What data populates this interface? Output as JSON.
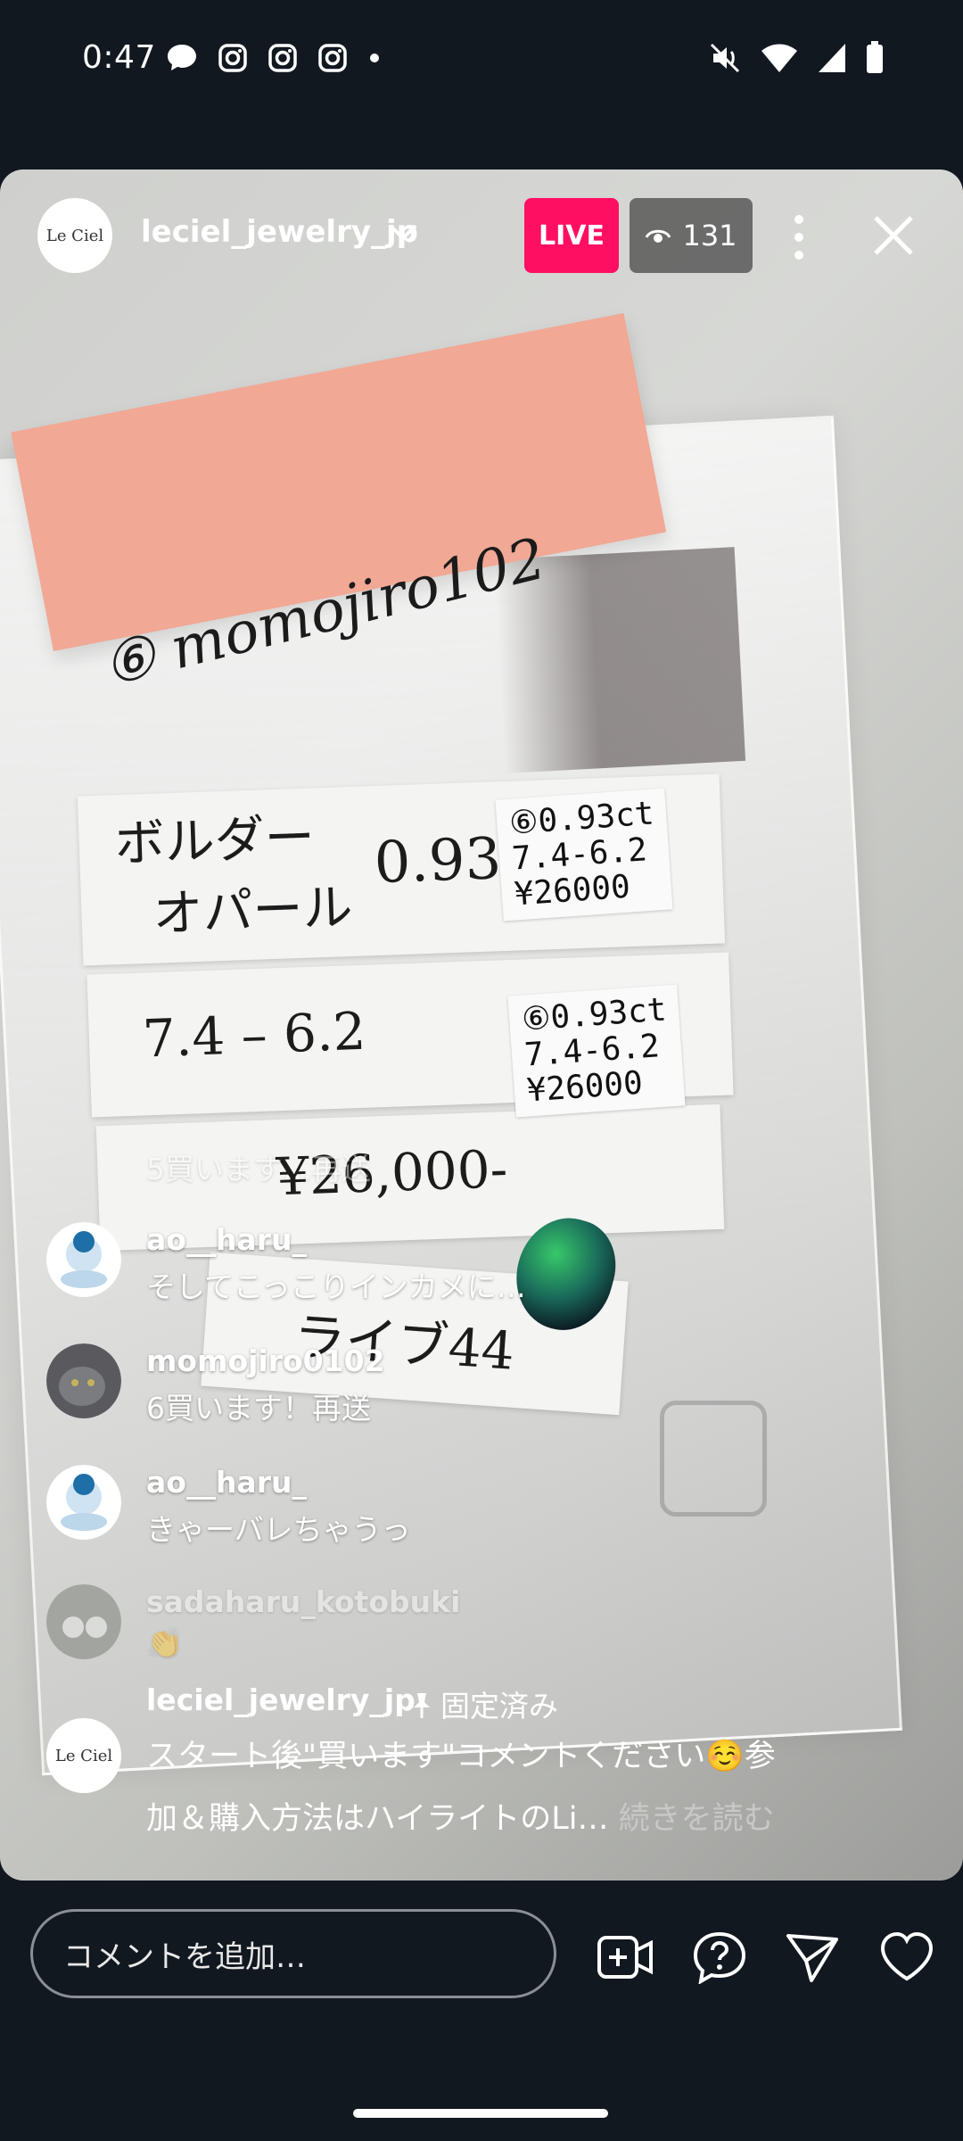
{
  "status_bar": {
    "time": "0:47",
    "left_icons": [
      "chat-bubble-icon",
      "instagram-icon",
      "instagram-icon",
      "instagram-icon",
      "dot-icon"
    ],
    "right_icons": [
      "mute-icon",
      "wifi-icon",
      "signal-icon",
      "battery-icon"
    ]
  },
  "live": {
    "host_avatar_text": "Le Ciel",
    "host_username": "leciel_jewelry_jp",
    "live_label": "LIVE",
    "viewer_count": "131",
    "colors": {
      "live_badge": "#ff0f62"
    }
  },
  "scene": {
    "sticky_note": "⑥ momojiro102",
    "card1_text": [
      "ボルダー",
      "オパール",
      "0.93ct"
    ],
    "card2_text": "7.4 – 6.2",
    "card3_text": "¥26,000-",
    "card4_text": "ライブ44",
    "label1": [
      "⑥0.93ct",
      "7.4-6.2",
      "¥26000"
    ],
    "label2": [
      "⑥0.93ct",
      "7.4-6.2",
      "¥26000"
    ]
  },
  "comments": [
    {
      "username": "",
      "text": "5買います…再送",
      "faded": true
    },
    {
      "username": "ao__haru_",
      "text": "そしてこっこりインカメに…"
    },
    {
      "username": "momojiro0102",
      "text": "6買います！再送"
    },
    {
      "username": "ao__haru_",
      "text": "きゃーバレちゃうっ"
    },
    {
      "username": "sadaharu_kotobuki",
      "text": "👏",
      "faded": true
    }
  ],
  "pinned": {
    "username": "leciel_jewelry_jp",
    "pinned_label": "固定済み",
    "line1": "スタート後\"買います\"コメントください☺️参",
    "line2": "加＆購入方法はハイライトのLi…",
    "read_more": "続きを読む"
  },
  "bottom_bar": {
    "comment_placeholder": "コメントを追加…",
    "icons": [
      "add-video-icon",
      "question-icon",
      "send-icon",
      "heart-icon"
    ]
  }
}
